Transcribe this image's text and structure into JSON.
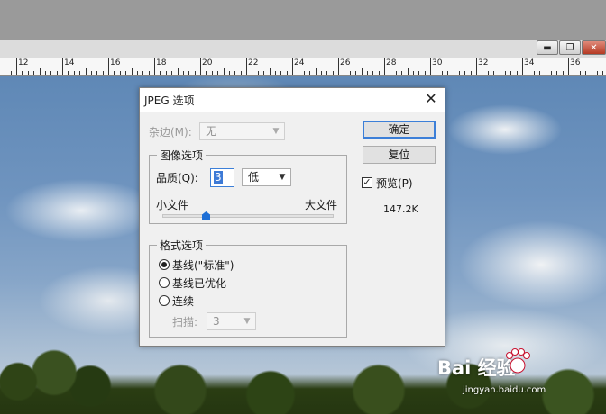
{
  "ruler": {
    "labels": [
      "12",
      "14",
      "16",
      "18",
      "20",
      "22",
      "24",
      "26",
      "28",
      "30",
      "32",
      "34",
      "36"
    ]
  },
  "window_controls": {
    "minimize_glyph": "▬",
    "restore_glyph": "❐",
    "close_glyph": "✕"
  },
  "dialog": {
    "title": "JPEG 选项",
    "close_glyph": "✕",
    "matte": {
      "label": "杂边(M):",
      "value": "无"
    },
    "image_options": {
      "title": "图像选项",
      "quality_label": "品质(Q):",
      "quality_value": "3",
      "quality_preset": "低",
      "small_file_label": "小文件",
      "large_file_label": "大文件",
      "slider_value": 3,
      "slider_max": 12
    },
    "format_options": {
      "title": "格式选项",
      "options": [
        "基线(\"标准\")",
        "基线已优化",
        "连续"
      ],
      "selected_index": 0,
      "scans_label": "扫描:",
      "scans_value": "3"
    },
    "buttons": {
      "ok": "确定",
      "reset": "复位"
    },
    "preview": {
      "label": "预览(P)",
      "checked": true,
      "size": "147.2K"
    }
  },
  "watermark": {
    "brand": "Bai 经验",
    "url": "jingyan.baidu.com"
  }
}
